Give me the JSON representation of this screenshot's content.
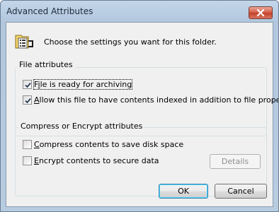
{
  "window": {
    "title": "Advanced Attributes",
    "close_icon": "close-icon"
  },
  "header": {
    "icon": "folder-properties-icon",
    "text": "Choose the settings you want for this folder."
  },
  "file_attributes": {
    "title": "File attributes",
    "archive": {
      "label": "File is ready for archiving",
      "checked": true,
      "accesskey": "i"
    },
    "index": {
      "label": "Allow this file to have contents indexed in addition to file properties",
      "checked": true,
      "accesskey": "A"
    }
  },
  "compress_encrypt": {
    "title": "Compress or Encrypt attributes",
    "compress": {
      "label": "Compress contents to save disk space",
      "checked": false,
      "accesskey": "C"
    },
    "encrypt": {
      "label": "Encrypt contents to secure data",
      "checked": false,
      "accesskey": "E"
    },
    "details_label": "Details"
  },
  "buttons": {
    "ok": "OK",
    "cancel": "Cancel"
  }
}
